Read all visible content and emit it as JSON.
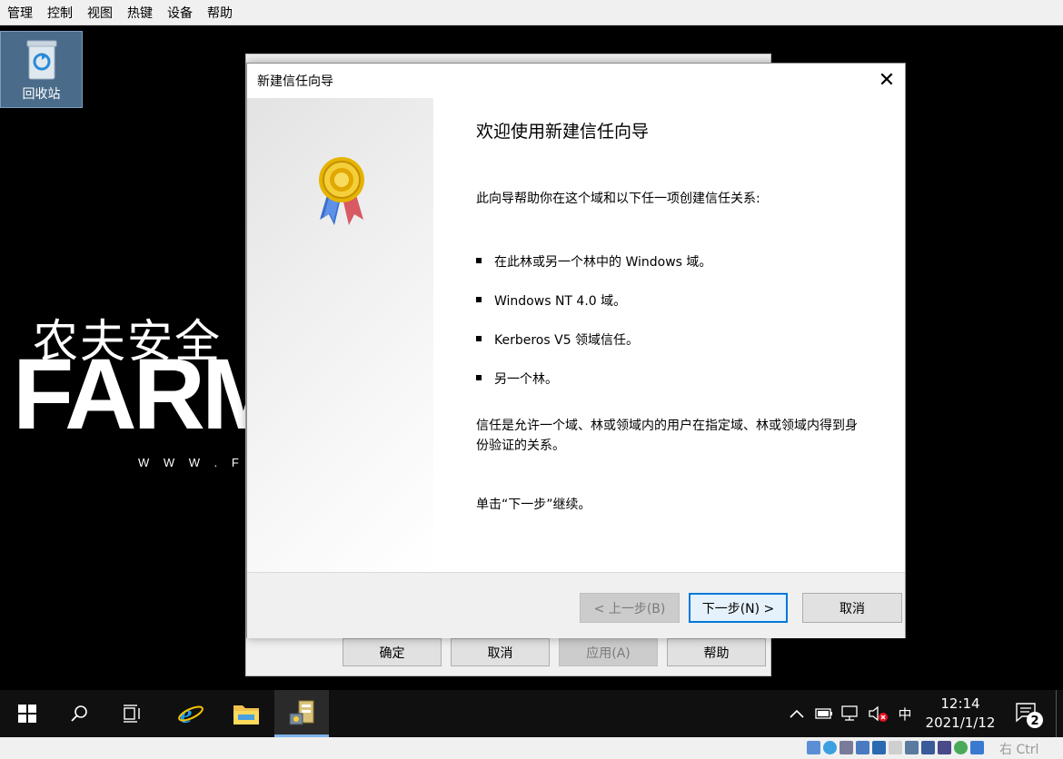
{
  "vm_menubar": {
    "items": [
      "管理",
      "控制",
      "视图",
      "热键",
      "设备",
      "帮助"
    ]
  },
  "desktop": {
    "recycle_bin_label": "回收站",
    "wallpaper": {
      "chinese": "农夫安全",
      "brand": "FARM",
      "url": "W W W . F A R M"
    }
  },
  "properties_window": {
    "buttons": {
      "ok": "确定",
      "cancel": "取消",
      "apply": "应用(A)",
      "help": "帮助"
    }
  },
  "wizard": {
    "title": "新建信任向导",
    "close_glyph": "✕",
    "heading": "欢迎使用新建信任向导",
    "intro": "此向导帮助你在这个域和以下任一项创建信任关系:",
    "bullets": [
      "在此林或另一个林中的 Windows 域。",
      "Windows NT 4.0 域。",
      "Kerberos V5 领域信任。",
      "另一个林。"
    ],
    "description": "信任是允许一个域、林或领域内的用户在指定域、林或领域内得到身份验证的关系。",
    "continue_hint": "单击“下一步”继续。",
    "buttons": {
      "back": "< 上一步(B)",
      "next": "下一步(N) >",
      "cancel": "取消"
    }
  },
  "taskbar": {
    "icons": [
      "windows-start-icon",
      "search-icon",
      "task-view-icon",
      "internet-explorer-icon",
      "file-explorer-icon",
      "active-directory-domains-trusts-icon"
    ],
    "ime_indicator": "中",
    "clock": {
      "time": "12:14",
      "date": "2021/1/12"
    },
    "notification_count": "2"
  },
  "vm_status": {
    "host_key": "右 Ctrl"
  },
  "colors": {
    "accent": "#0078d7",
    "taskbar": "#101010",
    "desktop": "#000000",
    "dialog_footer": "#f0f0f0"
  }
}
